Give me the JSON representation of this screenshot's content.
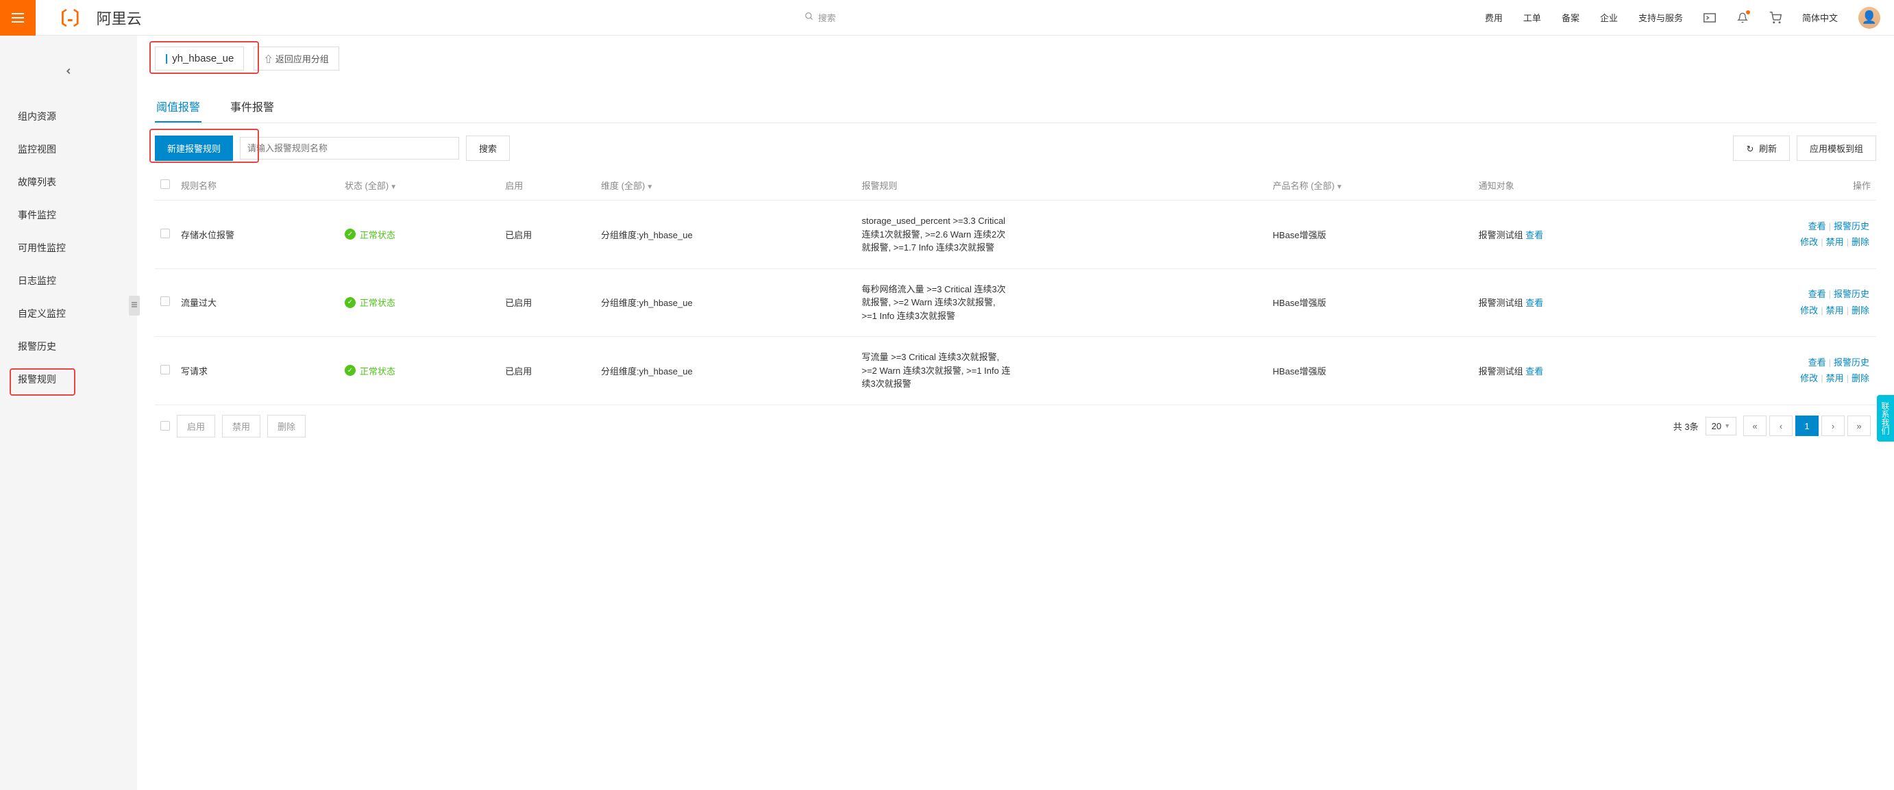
{
  "header": {
    "logo_text": "阿里云",
    "search_placeholder": "搜索",
    "nav": [
      "费用",
      "工单",
      "备案",
      "企业",
      "支持与服务"
    ],
    "language": "简体中文"
  },
  "sidebar": {
    "items": [
      "组内资源",
      "监控视图",
      "故障列表",
      "事件监控",
      "可用性监控",
      "日志监控",
      "自定义监控",
      "报警历史",
      "报警规则"
    ],
    "active_index": 8
  },
  "content": {
    "group_name": "yh_hbase_ue",
    "back_button": "返回应用分组",
    "tabs": [
      "阈值报警",
      "事件报警"
    ],
    "active_tab": 0,
    "toolbar": {
      "new_rule": "新建报警规则",
      "search_placeholder": "请输入报警规则名称",
      "search_btn": "搜索",
      "refresh_btn": "刷新",
      "apply_template": "应用模板到组"
    },
    "columns": {
      "rule_name": "规则名称",
      "status": "状态 (全部)",
      "enable": "启用",
      "dimension": "维度 (全部)",
      "rule": "报警规则",
      "product": "产品名称 (全部)",
      "notify": "通知对象",
      "actions": "操作"
    },
    "status_ok_text": "正常状态",
    "enabled_text": "已启用",
    "dimension_prefix": "分组维度:",
    "notify_target": "报警测试组",
    "view_link": "查看",
    "action_links": {
      "view": "查看",
      "history": "报警历史",
      "modify": "修改",
      "disable": "禁用",
      "delete": "删除"
    },
    "rows": [
      {
        "name": "存储水位报警",
        "dimension_value": "yh_hbase_ue",
        "rule_text": "storage_used_percent >=3.3  Critical 连续1次就报警, >=2.6 Warn 连续2次就报警, >=1.7 Info 连续3次就报警",
        "product": "HBase增强版"
      },
      {
        "name": "流量过大",
        "dimension_value": "yh_hbase_ue",
        "rule_text": "每秒网络流入量 >=3 Critical 连续3次就报警, >=2 Warn 连续3次就报警, >=1 Info 连续3次就报警",
        "product": "HBase增强版"
      },
      {
        "name": "写请求",
        "dimension_value": "yh_hbase_ue",
        "rule_text": "写流量 >=3 Critical 连续3次就报警, >=2 Warn 连续3次就报警, >=1 Info 连续3次就报警",
        "product": "HBase增强版"
      }
    ],
    "footer": {
      "enable_btn": "启用",
      "disable_btn": "禁用",
      "delete_btn": "删除",
      "total_text": "共 3条",
      "page_size": "20",
      "current_page": "1"
    }
  },
  "feedback": "联系我们"
}
